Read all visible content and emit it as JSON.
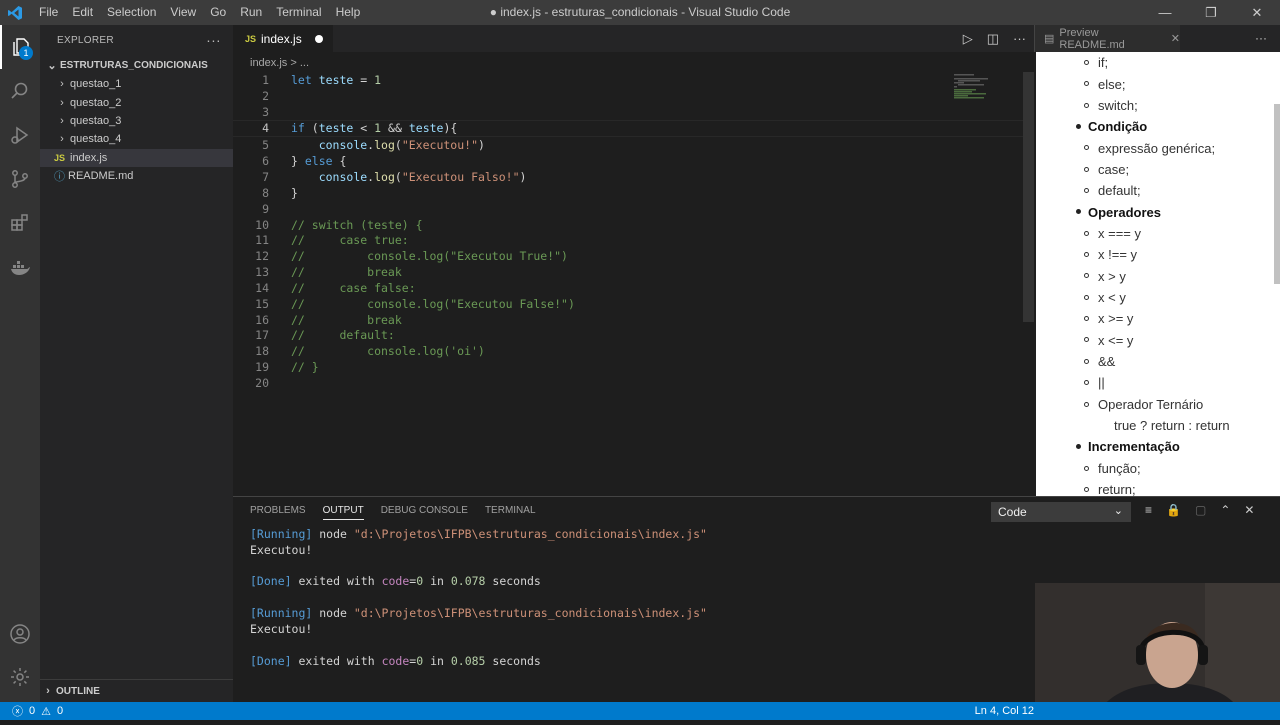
{
  "window": {
    "title": "● index.js - estruturas_condicionais - Visual Studio Code",
    "menu": [
      "File",
      "Edit",
      "Selection",
      "View",
      "Go",
      "Run",
      "Terminal",
      "Help"
    ]
  },
  "activity_bar": {
    "icons": [
      "files-icon",
      "search-icon",
      "run-debug-icon",
      "source-control-icon",
      "extensions-icon",
      "docker-icon"
    ],
    "bottom_icons": [
      "account-icon",
      "settings-gear-icon"
    ],
    "badge": "1"
  },
  "explorer": {
    "header": "EXPLORER",
    "more": "···",
    "folder": "ESTRUTURAS_CONDICIONAIS",
    "items": [
      {
        "label": "questao_1",
        "type": "folder"
      },
      {
        "label": "questao_2",
        "type": "folder"
      },
      {
        "label": "questao_3",
        "type": "folder"
      },
      {
        "label": "questao_4",
        "type": "folder"
      },
      {
        "label": "index.js",
        "type": "js"
      },
      {
        "label": "README.md",
        "type": "info"
      }
    ],
    "outline": "OUTLINE"
  },
  "editor": {
    "tab_label": "index.js",
    "tab_icon": "JS",
    "breadcrumb": "index.js > ...",
    "current_line": 4,
    "line_numbers": [
      "1",
      "2",
      "3",
      "4",
      "5",
      "6",
      "7",
      "8",
      "9",
      "10",
      "11",
      "12",
      "13",
      "14",
      "15",
      "16",
      "17",
      "18",
      "19",
      "20"
    ],
    "lines": [
      "let teste = 1",
      "",
      "",
      "if (teste < 1 && teste){",
      "    console.log(\"Executou!\")",
      "} else {",
      "    console.log(\"Executou Falso!\")",
      "}",
      "",
      "// switch (teste) {",
      "//     case true:",
      "//         console.log(\"Executou True!\")",
      "//         break",
      "//     case false:",
      "//         console.log(\"Executou False!\")",
      "//         break",
      "//     default:",
      "//         console.log('oi')",
      "// }",
      ""
    ]
  },
  "preview": {
    "tab_label": "Preview README.md",
    "items": [
      {
        "kind": "sub",
        "text": "if;"
      },
      {
        "kind": "sub",
        "text": "else;"
      },
      {
        "kind": "sub",
        "text": "switch;"
      },
      {
        "kind": "main",
        "text": "Condição"
      },
      {
        "kind": "sub",
        "text": "expressão genérica;"
      },
      {
        "kind": "sub",
        "text": "case;"
      },
      {
        "kind": "sub",
        "text": "default;"
      },
      {
        "kind": "main",
        "text": "Operadores"
      },
      {
        "kind": "sub",
        "text": "x === y"
      },
      {
        "kind": "sub",
        "text": "x !== y"
      },
      {
        "kind": "sub",
        "text": "x > y"
      },
      {
        "kind": "sub",
        "text": "x < y"
      },
      {
        "kind": "sub",
        "text": "x >= y"
      },
      {
        "kind": "sub",
        "text": "x <= y"
      },
      {
        "kind": "sub",
        "text": "&&"
      },
      {
        "kind": "sub",
        "text": "||"
      },
      {
        "kind": "sub",
        "text": "Operador Ternário"
      },
      {
        "kind": "cont",
        "text": "true ? return : return"
      },
      {
        "kind": "main",
        "text": "Incrementação"
      },
      {
        "kind": "sub",
        "text": "função;"
      },
      {
        "kind": "sub",
        "text": "return;"
      }
    ]
  },
  "panel": {
    "tabs": [
      "PROBLEMS",
      "OUTPUT",
      "DEBUG CONSOLE",
      "TERMINAL"
    ],
    "active_tab": "OUTPUT",
    "channel": "Code",
    "output": [
      {
        "t": "running",
        "a": "[Running]",
        "b": " node ",
        "c": "\"d:\\Projetos\\IFPB\\estruturas_condicionais\\index.js\""
      },
      {
        "t": "plain",
        "a": "Executou!"
      },
      {
        "t": "blank"
      },
      {
        "t": "done",
        "a": "[Done]",
        "b": " exited with ",
        "c": "code",
        "d": "=",
        "e": "0",
        "f": " in ",
        "g": "0.078",
        "h": " seconds"
      },
      {
        "t": "blank"
      },
      {
        "t": "running",
        "a": "[Running]",
        "b": " node ",
        "c": "\"d:\\Projetos\\IFPB\\estruturas_condicionais\\index.js\""
      },
      {
        "t": "plain",
        "a": "Executou!"
      },
      {
        "t": "blank"
      },
      {
        "t": "done",
        "a": "[Done]",
        "b": " exited with ",
        "c": "code",
        "d": "=",
        "e": "0",
        "f": " in ",
        "g": "0.085",
        "h": " seconds"
      }
    ]
  },
  "status": {
    "errors": "0",
    "warnings": "0",
    "position": "Ln 4, Col 12"
  }
}
